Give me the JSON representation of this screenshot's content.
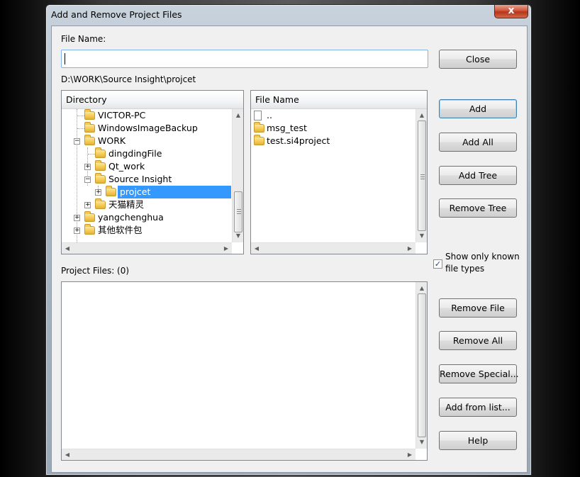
{
  "window": {
    "title": "Add and Remove Project Files",
    "close_glyph": "x"
  },
  "file_name": {
    "label": "File Name:",
    "value": ""
  },
  "current_path": "D:\\WORK\\Source Insight\\projcet",
  "directory": {
    "header": "Directory",
    "items": [
      {
        "label": "VICTOR-PC",
        "expander": ""
      },
      {
        "label": "WindowsImageBackup",
        "expander": ""
      },
      {
        "label": "WORK",
        "expander": "−"
      },
      {
        "label": "dingdingFile",
        "expander": ""
      },
      {
        "label": "Qt_work",
        "expander": "+"
      },
      {
        "label": "Source Insight",
        "expander": "−"
      },
      {
        "label": "projcet",
        "expander": "+",
        "selected": true
      },
      {
        "label": "天猫精灵",
        "expander": "+"
      },
      {
        "label": "yangchenghua",
        "expander": "+"
      },
      {
        "label": "其他软件包",
        "expander": "+"
      }
    ]
  },
  "file_list": {
    "header": "File Name",
    "items": [
      {
        "label": "..",
        "icon": "document-icon"
      },
      {
        "label": "msg_test",
        "icon": "folder-icon"
      },
      {
        "label": "test.si4project",
        "icon": "folder-icon"
      }
    ]
  },
  "show_known_types": {
    "checked": true,
    "check_glyph": "✓",
    "line1": "Show only known",
    "line2": "file types"
  },
  "project_files": {
    "label": "Project Files: (0)"
  },
  "buttons": {
    "close": "Close",
    "add": "Add",
    "add_all": "Add All",
    "add_tree": "Add Tree",
    "remove_tree": "Remove Tree",
    "remove_file": "Remove File",
    "remove_all": "Remove All",
    "remove_special": "Remove Special...",
    "add_from_list": "Add from list...",
    "help": "Help"
  },
  "scroll_arrows": {
    "up": "▲",
    "down": "▼",
    "left": "◀",
    "right": "▶"
  },
  "colors": {
    "selection": "#3399ff",
    "title_close_button": "#c9462b"
  }
}
